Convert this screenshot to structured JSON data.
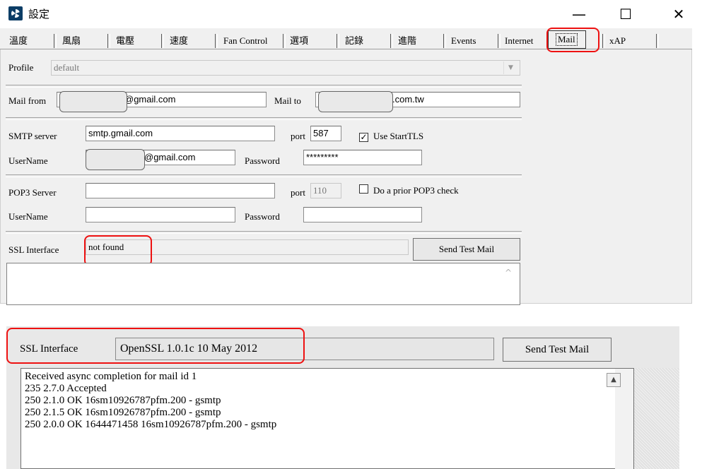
{
  "window": {
    "title": "設定",
    "controls": {
      "minimize": "—",
      "maximize": "☐",
      "close": "✕"
    }
  },
  "tabs": [
    {
      "label": "溫度"
    },
    {
      "label": "風扇"
    },
    {
      "label": "電壓"
    },
    {
      "label": "速度"
    },
    {
      "label": "Fan Control"
    },
    {
      "label": "選項"
    },
    {
      "label": "記錄"
    },
    {
      "label": "進階"
    },
    {
      "label": "Events"
    },
    {
      "label": "Internet"
    },
    {
      "label": "Mail",
      "selected": true
    },
    {
      "label": "xAP"
    }
  ],
  "form": {
    "profile_label": "Profile",
    "profile_value": "default",
    "mail_from_label": "Mail from",
    "mail_from_value": "@gmail.com",
    "mail_to_label": "Mail to",
    "mail_to_value": ".com.tw",
    "smtp_server_label": "SMTP server",
    "smtp_server_value": "smtp.gmail.com",
    "smtp_port_label": "port",
    "smtp_port_value": "587",
    "use_starttls_label": "Use StartTLS",
    "use_starttls_checked": true,
    "smtp_username_label": "UserName",
    "smtp_username_value": "@gmail.com",
    "smtp_password_label": "Password",
    "smtp_password_value": "*********",
    "pop3_server_label": "POP3 Server",
    "pop3_server_value": "",
    "pop3_port_label": "port",
    "pop3_port_value": "110",
    "pop3_check_label": "Do a prior POP3 check",
    "pop3_check_checked": false,
    "pop3_username_label": "UserName",
    "pop3_password_label": "Password",
    "ssl_label": "SSL Interface",
    "ssl_value": "not found",
    "send_test_label": "Send Test Mail",
    "scroll_up": "^"
  },
  "detail": {
    "ssl_label": "SSL Interface",
    "ssl_value": "OpenSSL 1.0.1c 10 May 2012",
    "send_test_label": "Send Test Mail",
    "scroll_up": "▲",
    "log": [
      "Received async completion for mail id 1",
      "235 2.7.0 Accepted",
      "250 2.1.0 OK 16sm10926787pfm.200 - gsmtp",
      "250 2.1.5 OK 16sm10926787pfm.200 - gsmtp",
      "250 2.0.0 OK  1644471458 16sm10926787pfm.200 - gsmtp"
    ]
  },
  "colors": {
    "highlight": "#e11111",
    "dialog_bg": "#f0f0f0",
    "title_bg": "#ffffff"
  }
}
